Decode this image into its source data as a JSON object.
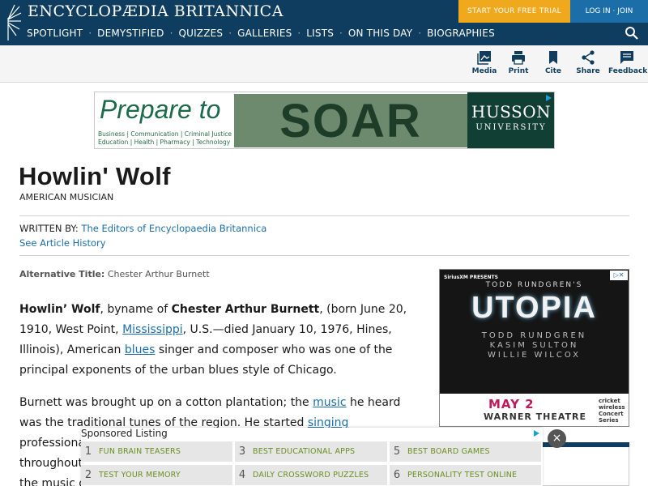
{
  "header": {
    "logo_text": "ENCYCLOPÆDIA BRITANNICA",
    "trial_label": "START YOUR FREE TRIAL",
    "login_label": "LOG IN · JOIN",
    "nav": [
      "SPOTLIGHT",
      "DEMYSTIFIED",
      "QUIZZES",
      "GALLERIES",
      "LISTS",
      "ON THIS DAY",
      "BIOGRAPHIES"
    ],
    "colors": {
      "bar": "#0f3d5f",
      "trial": "#f0a81c",
      "login": "#1b6ea8"
    }
  },
  "toolbar": {
    "media": "Media",
    "print": "Print",
    "cite": "Cite",
    "share": "Share",
    "feedback": "Feedback"
  },
  "banner_ad": {
    "headline": "Prepare to",
    "tagline_1": "Business | Communication | Criminal Justice",
    "tagline_2": "Education | Health | Pharmacy | Technology",
    "big_word": "SOAR",
    "brand": "HUSSON",
    "brand_sub": "UNIVERSITY"
  },
  "article": {
    "title": "Howlin' Wolf",
    "subtitle": "AMERICAN MUSICIAN",
    "written_by_label": "WRITTEN BY:",
    "author": "The Editors of Encyclopaedia Britannica",
    "history_link": "See Article History",
    "alt_title_label": "Alternative Title:",
    "alt_title": "Chester Arthur Burnett",
    "p1": {
      "name": "Howlin’ Wolf",
      "t1": ", byname of ",
      "full_name": "Chester Arthur Burnett",
      "t2": ", (born June 20, 1910, West Point, ",
      "link_mississippi": "Mississippi",
      "t3": ", U.S.—died January 10, 1976, Hines, Illinois), American ",
      "link_blues": "blues",
      "t4": " singer and composer who was one of the principal exponents of the urban blues style of Chicago."
    },
    "p2": {
      "t1": "Burnett was brought up on a cotton plantation; the ",
      "link_music": "music",
      "t2": " he heard was the traditional tunes of the region. He started ",
      "link_singing": "singing",
      "t3": " professionally",
      "t4": "throughout",
      "t5": "the music o"
    }
  },
  "side_ad": {
    "sirius": "SiriusXM PRESENTS",
    "headliner": "TODD RUNDGREN'S",
    "show": "UTOPIA",
    "names": [
      "TODD RUNDGREN",
      "KASIM SULTON",
      "WILLIE WILCOX"
    ],
    "date": "MAY 2",
    "venue": "WARNER THEATRE",
    "sponsor": "cricket wireless Concert Series"
  },
  "sponsored": {
    "title": "Sponsored Listing",
    "items": [
      {
        "num": "1",
        "label": "FUN BRAIN TEASERS"
      },
      {
        "num": "3",
        "label": "BEST EDUCATIONAL APPS"
      },
      {
        "num": "5",
        "label": "BEST BOARD GAMES"
      },
      {
        "num": "2",
        "label": "TEST YOUR MEMORY"
      },
      {
        "num": "4",
        "label": "DAILY CROSSWORD PUZZLES"
      },
      {
        "num": "6",
        "label": "PERSONALITY TEST ONLINE"
      }
    ],
    "close": "×"
  }
}
